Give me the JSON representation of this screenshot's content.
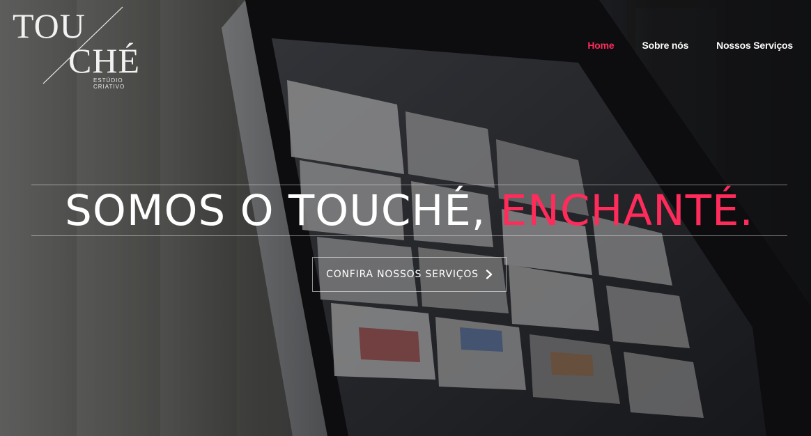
{
  "brand": {
    "logo_line1": "TOU",
    "logo_line2": "CHÉ",
    "logo_tagline": "ESTÚDIO CRIATIVO"
  },
  "nav": {
    "items": [
      {
        "label": "Home",
        "active": true
      },
      {
        "label": "Sobre nós",
        "active": false
      },
      {
        "label": "Nossos Serviços",
        "active": false
      }
    ]
  },
  "hero": {
    "headline_main": "SOMOS O TOUCHÉ, ",
    "headline_accent": "ENCHANTÉ.",
    "cta_label": "CONFIRA NOSSOS SERVIÇOS"
  },
  "colors": {
    "accent": "#ff2b5b",
    "text": "#ffffff"
  },
  "icons": {
    "cta_icon": "chevron-right-icon"
  }
}
